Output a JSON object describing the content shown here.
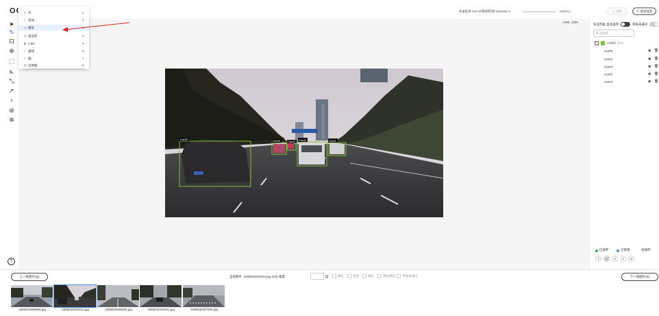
{
  "app": {
    "logo": "OC"
  },
  "header": {
    "task_label": "标准任务 test-2D矩形检测-1321331-0",
    "progress_text": "0/5(0%)",
    "progress": 0,
    "save_label": "上 保存",
    "exit_label": "⊙ 退出任务"
  },
  "canvas": {
    "coord": "-1005, 1088"
  },
  "tools_menu": [
    {
      "icon": "•",
      "label": "点",
      "key": "1"
    },
    {
      "icon": "⟋",
      "label": "实线",
      "key": "2"
    },
    {
      "icon": "▢",
      "label": "矩形",
      "key": "3"
    },
    {
      "icon": "⌬",
      "label": "多边形",
      "key": "4"
    },
    {
      "icon": "⧈",
      "label": "2.5D",
      "key": "5"
    },
    {
      "icon": "⟋",
      "label": "虚线",
      "key": "6"
    },
    {
      "icon": "○",
      "label": "圆",
      "key": "7"
    },
    {
      "icon": "⊡",
      "label": "立体框",
      "key": "8"
    }
  ],
  "image": {
    "boxes": [
      {
        "label": "Car#2"
      },
      {
        "label": "Car#3"
      },
      {
        "label": "Car#4"
      },
      {
        "label": "Car#0"
      },
      {
        "label": "Car#1"
      }
    ]
  },
  "right_panel": {
    "title": "标注列表 自动排序",
    "review_label": "审核未通过",
    "search_placeholder": "标注搜索",
    "group_label": "Car(5)",
    "group_id": "0411",
    "items": [
      "Car#0",
      "Car#1",
      "Car#4",
      "Car#2",
      "Car#3"
    ],
    "legend": {
      "saved": "已保存",
      "modified": "已修改",
      "unsaved": "未保存"
    },
    "pages": [
      "1",
      "2",
      "3",
      "4",
      "5"
    ]
  },
  "bottom": {
    "prev_label": "上一张图片(Q)",
    "next_label": "下一张图片(E)",
    "current_file": "当前图片: 1686529425315.jpg (2/5)   角度",
    "degree_unit": "度",
    "checks": [
      "确认",
      "无效",
      "跳过",
      "审核通过",
      "审核未通过"
    ],
    "thumbnails": [
      "1686529380858.jpg",
      "1686529425315.jpg",
      "1686529466966.jpg",
      "1686530449201.jpg",
      "1686530467909.jpg"
    ]
  },
  "colors": {
    "accent": "#4a90e2",
    "box": "#7ec233",
    "arrow": "#d9261c"
  }
}
